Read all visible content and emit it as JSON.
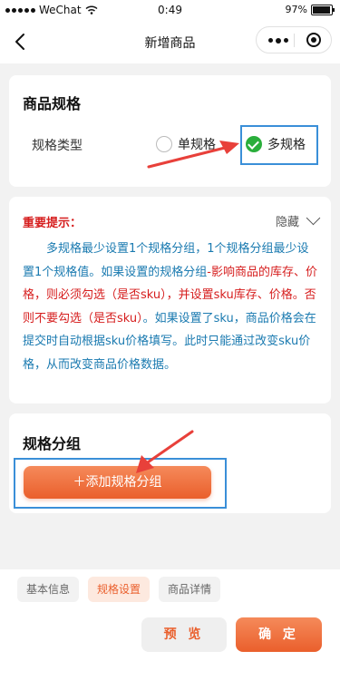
{
  "status_bar": {
    "carrier": "WeChat",
    "time": "0:49",
    "battery": "97%"
  },
  "nav": {
    "title": "新增商品"
  },
  "spec_card": {
    "title": "商品规格",
    "type_label": "规格类型",
    "option_single": "单规格",
    "option_multi": "多规格"
  },
  "note_card": {
    "title": "重要提示：",
    "toggle_label": "隐藏",
    "text_1": "多规格最少设置1个规格分组，1个规格分组最少设置1个规格值。如果设置的规格分组",
    "text_red": "-影响商品的库存、价格，则必须勾选（是否sku），并设置sku库存、价格。否则不要勾选（是否sku）",
    "text_2": "。如果设置了sku，商品价格会在提交时自动根据sku价格填写。此时只能通过改变sku价格，从而改变商品价格数据。"
  },
  "group_card": {
    "title": "规格分组",
    "add_button": "＋添加规格分组"
  },
  "bottom": {
    "tabs": [
      "基本信息",
      "规格设置",
      "商品详情"
    ],
    "preview_button": "预 览",
    "confirm_button": "确 定"
  },
  "colors": {
    "accent": "#ea5f2c",
    "check": "#2aae3b",
    "highlight": "#3a8fd8",
    "note_text": "#1a7ab0",
    "warning": "#d61e1e"
  }
}
